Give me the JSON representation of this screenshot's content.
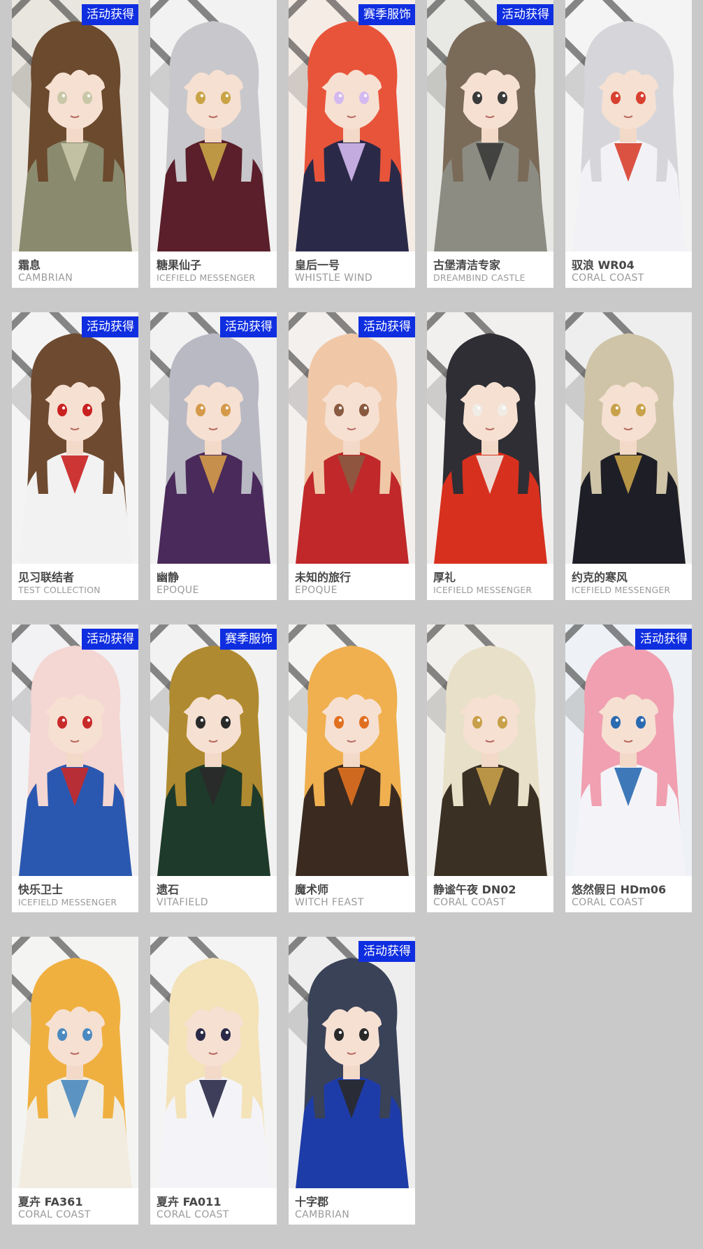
{
  "skins": [
    {
      "name": "霜息",
      "series": "CAMBRIAN",
      "badge": "活动获得",
      "hair": "#6b4a2e",
      "outfit": "#8a8a6e",
      "bg": "#e9e6df",
      "accent": "#c8c7a8"
    },
    {
      "name": "糖果仙子",
      "series": "ICEFIELD MESSENGER",
      "badge": "",
      "hair": "#c8c8cc",
      "outfit": "#5a1f2a",
      "bg": "#f2f2f2",
      "accent": "#c9a447"
    },
    {
      "name": "皇后一号",
      "series": "WHISTLE WIND",
      "badge": "赛季服饰",
      "hair": "#e8543a",
      "outfit": "#2a2a48",
      "bg": "#f5ece6",
      "accent": "#d4b9f0"
    },
    {
      "name": "古堡清洁专家",
      "series": "DREAMBIND CASTLE",
      "badge": "活动获得",
      "hair": "#7a6a58",
      "outfit": "#8c8c82",
      "bg": "#e8e8e4",
      "accent": "#3a3a3a"
    },
    {
      "name": "驭浪 WR04",
      "series": "CORAL COAST",
      "badge": "",
      "hair": "#d6d6da",
      "outfit": "#f2f2f6",
      "bg": "#f4f4f4",
      "accent": "#d84030"
    },
    {
      "name": "见习联结者",
      "series": "TEST COLLECTION",
      "badge": "活动获得",
      "hair": "#6e4a30",
      "outfit": "#f2f2f2",
      "bg": "#f4f4f4",
      "accent": "#c92020"
    },
    {
      "name": "幽静",
      "series": "EPOQUE",
      "badge": "活动获得",
      "hair": "#b9b9c4",
      "outfit": "#4a2a5a",
      "bg": "#f2f2f2",
      "accent": "#d49a4a"
    },
    {
      "name": "未知的旅行",
      "series": "EPOQUE",
      "badge": "活动获得",
      "hair": "#f0c8a8",
      "outfit": "#c0282a",
      "bg": "#f4f0ee",
      "accent": "#8a5a40"
    },
    {
      "name": "厚礼",
      "series": "ICEFIELD MESSENGER",
      "badge": "",
      "hair": "#2e2e34",
      "outfit": "#d8301e",
      "bg": "#f2f0ee",
      "accent": "#f0ece6"
    },
    {
      "name": "约克的寒风",
      "series": "ICEFIELD MESSENGER",
      "badge": "",
      "hair": "#cfc4a8",
      "outfit": "#1e1e26",
      "bg": "#eeeeee",
      "accent": "#c8a24a"
    },
    {
      "name": "快乐卫士",
      "series": "ICEFIELD MESSENGER",
      "badge": "活动获得",
      "hair": "#f4d6d2",
      "outfit": "#2a58b0",
      "bg": "#f2f2f4",
      "accent": "#c82a2a"
    },
    {
      "name": "遗石",
      "series": "VITAFIELD",
      "badge": "赛季服饰",
      "hair": "#b08a30",
      "outfit": "#1e3a2a",
      "bg": "#f2f2f2",
      "accent": "#2a2a2a"
    },
    {
      "name": "魔术师",
      "series": "WITCH FEAST",
      "badge": "",
      "hair": "#f0b050",
      "outfit": "#3a2a20",
      "bg": "#f4f4f2",
      "accent": "#e07020"
    },
    {
      "name": "静谧午夜 DN02",
      "series": "CORAL COAST",
      "badge": "",
      "hair": "#e8e0c8",
      "outfit": "#3a3024",
      "bg": "#f2f0ec",
      "accent": "#c8a04a"
    },
    {
      "name": "悠然假日 HDm06",
      "series": "CORAL COAST",
      "badge": "活动获得",
      "hair": "#f0a0b0",
      "outfit": "#f4f4f8",
      "bg": "#eef2f6",
      "accent": "#2a6ab0"
    },
    {
      "name": "夏卉 FA361",
      "series": "CORAL COAST",
      "badge": "",
      "hair": "#f0b040",
      "outfit": "#f2ece0",
      "bg": "#f4f4f2",
      "accent": "#4a8ac0"
    },
    {
      "name": "夏卉 FA011",
      "series": "CORAL COAST",
      "badge": "",
      "hair": "#f4e2b8",
      "outfit": "#f4f4f8",
      "bg": "#f4f4f4",
      "accent": "#2a2a48"
    },
    {
      "name": "十字郡",
      "series": "CAMBRIAN",
      "badge": "活动获得",
      "hair": "#3a4258",
      "outfit": "#1e3ca8",
      "bg": "#eeeeee",
      "accent": "#2a2a2a"
    }
  ]
}
